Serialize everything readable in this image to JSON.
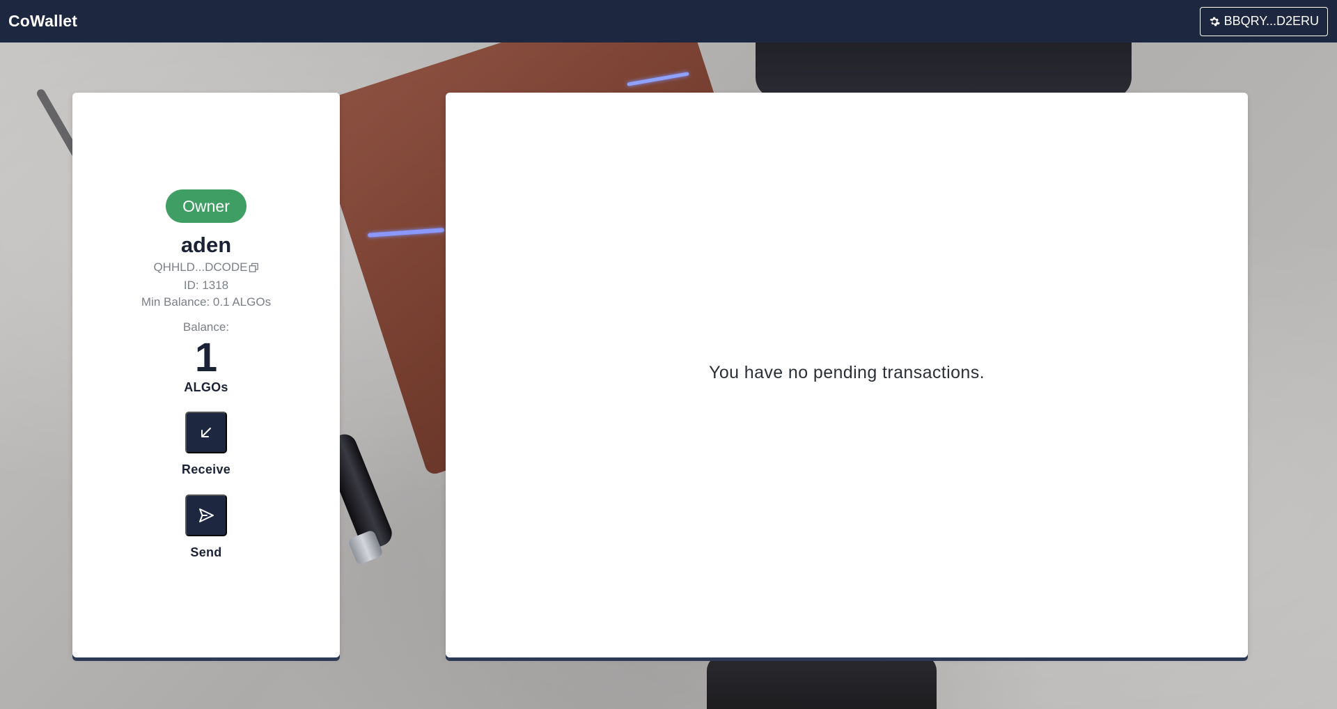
{
  "app": {
    "brand": "CoWallet"
  },
  "header": {
    "account_label": "BBQRY...D2ERU",
    "account_icon": "gear-icon"
  },
  "wallet": {
    "role": "Owner",
    "role_color": "#3f9e63",
    "name": "aden",
    "address_short": "QHHLD...DCODE",
    "id_text": "ID: 1318",
    "min_balance_text": "Min Balance: 0.1 ALGOs",
    "balance_label": "Balance:",
    "balance_value": "1",
    "balance_unit": "ALGOs"
  },
  "actions": {
    "receive_label": "Receive",
    "receive_icon": "arrow-down-left-icon",
    "send_label": "Send",
    "send_icon": "send-icon"
  },
  "transactions": {
    "empty_message": "You have no pending transactions."
  },
  "colors": {
    "topbar": "#1e2740",
    "accent_dark": "#1e2740",
    "owner_badge": "#3f9e63"
  }
}
